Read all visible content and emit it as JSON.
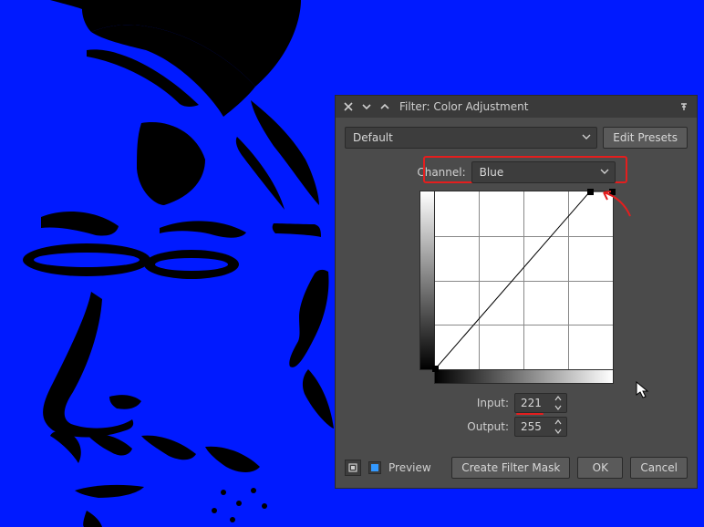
{
  "dialog": {
    "title": "Filter: Color Adjustment",
    "preset_value": "Default",
    "edit_presets": "Edit Presets",
    "channel_label": "Channel:",
    "channel_value": "Blue",
    "input_label": "Input:",
    "input_value": "221",
    "output_label": "Output:",
    "output_value": "255",
    "preview_label": "Preview",
    "create_mask": "Create Filter Mask",
    "ok": "OK",
    "cancel": "Cancel"
  }
}
